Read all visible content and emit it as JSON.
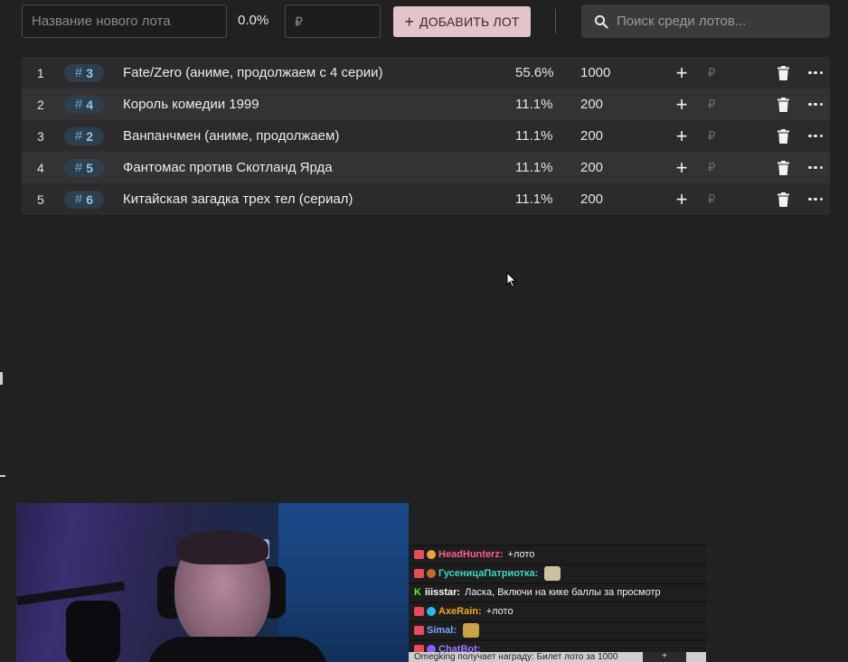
{
  "toolbar": {
    "lot_name_placeholder": "Название нового лота",
    "percent": "0.0%",
    "amount_placeholder": "₽",
    "add_lot_label": "ДОБАВИТЬ ЛОТ",
    "search_placeholder": "Поиск среди лотов..."
  },
  "lots": [
    {
      "index": "1",
      "id": "3",
      "title": "Fate/Zero (аниме, продолжаем с 4 серии)",
      "percent": "55.6%",
      "amount": "1000"
    },
    {
      "index": "2",
      "id": "4",
      "title": "Король комедии 1999",
      "percent": "11.1%",
      "amount": "200"
    },
    {
      "index": "3",
      "id": "2",
      "title": "Ванпанчмен (аниме, продолжаем)",
      "percent": "11.1%",
      "amount": "200"
    },
    {
      "index": "4",
      "id": "5",
      "title": "Фантомас против Скотланд Ярда",
      "percent": "11.1%",
      "amount": "200"
    },
    {
      "index": "5",
      "id": "6",
      "title": "Китайская загадка трех тел (сериал)",
      "percent": "11.1%",
      "amount": "200"
    }
  ],
  "row_icons": {
    "add": "plus-icon",
    "currency": "ruble-icon",
    "delete": "trash-icon",
    "more": "more-horizontal-icon"
  },
  "currency_symbol": "₽",
  "hash_symbol": "#",
  "chat": {
    "messages": [
      {
        "user": "HeadHunterz:",
        "user_color": "#ff5c8a",
        "text": "+лото"
      },
      {
        "user": "ГусеницаПатриотка:",
        "user_color": "#3fd6c6",
        "text": ""
      },
      {
        "user": "iiisstar:",
        "user_color": "#ffffff",
        "text": "Ласка, Включи на кике баллы за просмотр"
      },
      {
        "user": "AxeRain:",
        "user_color": "#f5a623",
        "text": "+лото"
      },
      {
        "user": "Simal:",
        "user_color": "#6ea8ff",
        "text": ""
      },
      {
        "user": "ChatBot:",
        "user_color": "#9b7bff",
        "text": ""
      }
    ],
    "footer_text": "Omegking получает награду: Билет лото за 1000",
    "footer_plus": "+"
  },
  "colors": {
    "background": "#212121",
    "add_button": "#e3c4c8",
    "badge_bg": "#2f3e4d",
    "badge_text": "#8ec5f0"
  }
}
